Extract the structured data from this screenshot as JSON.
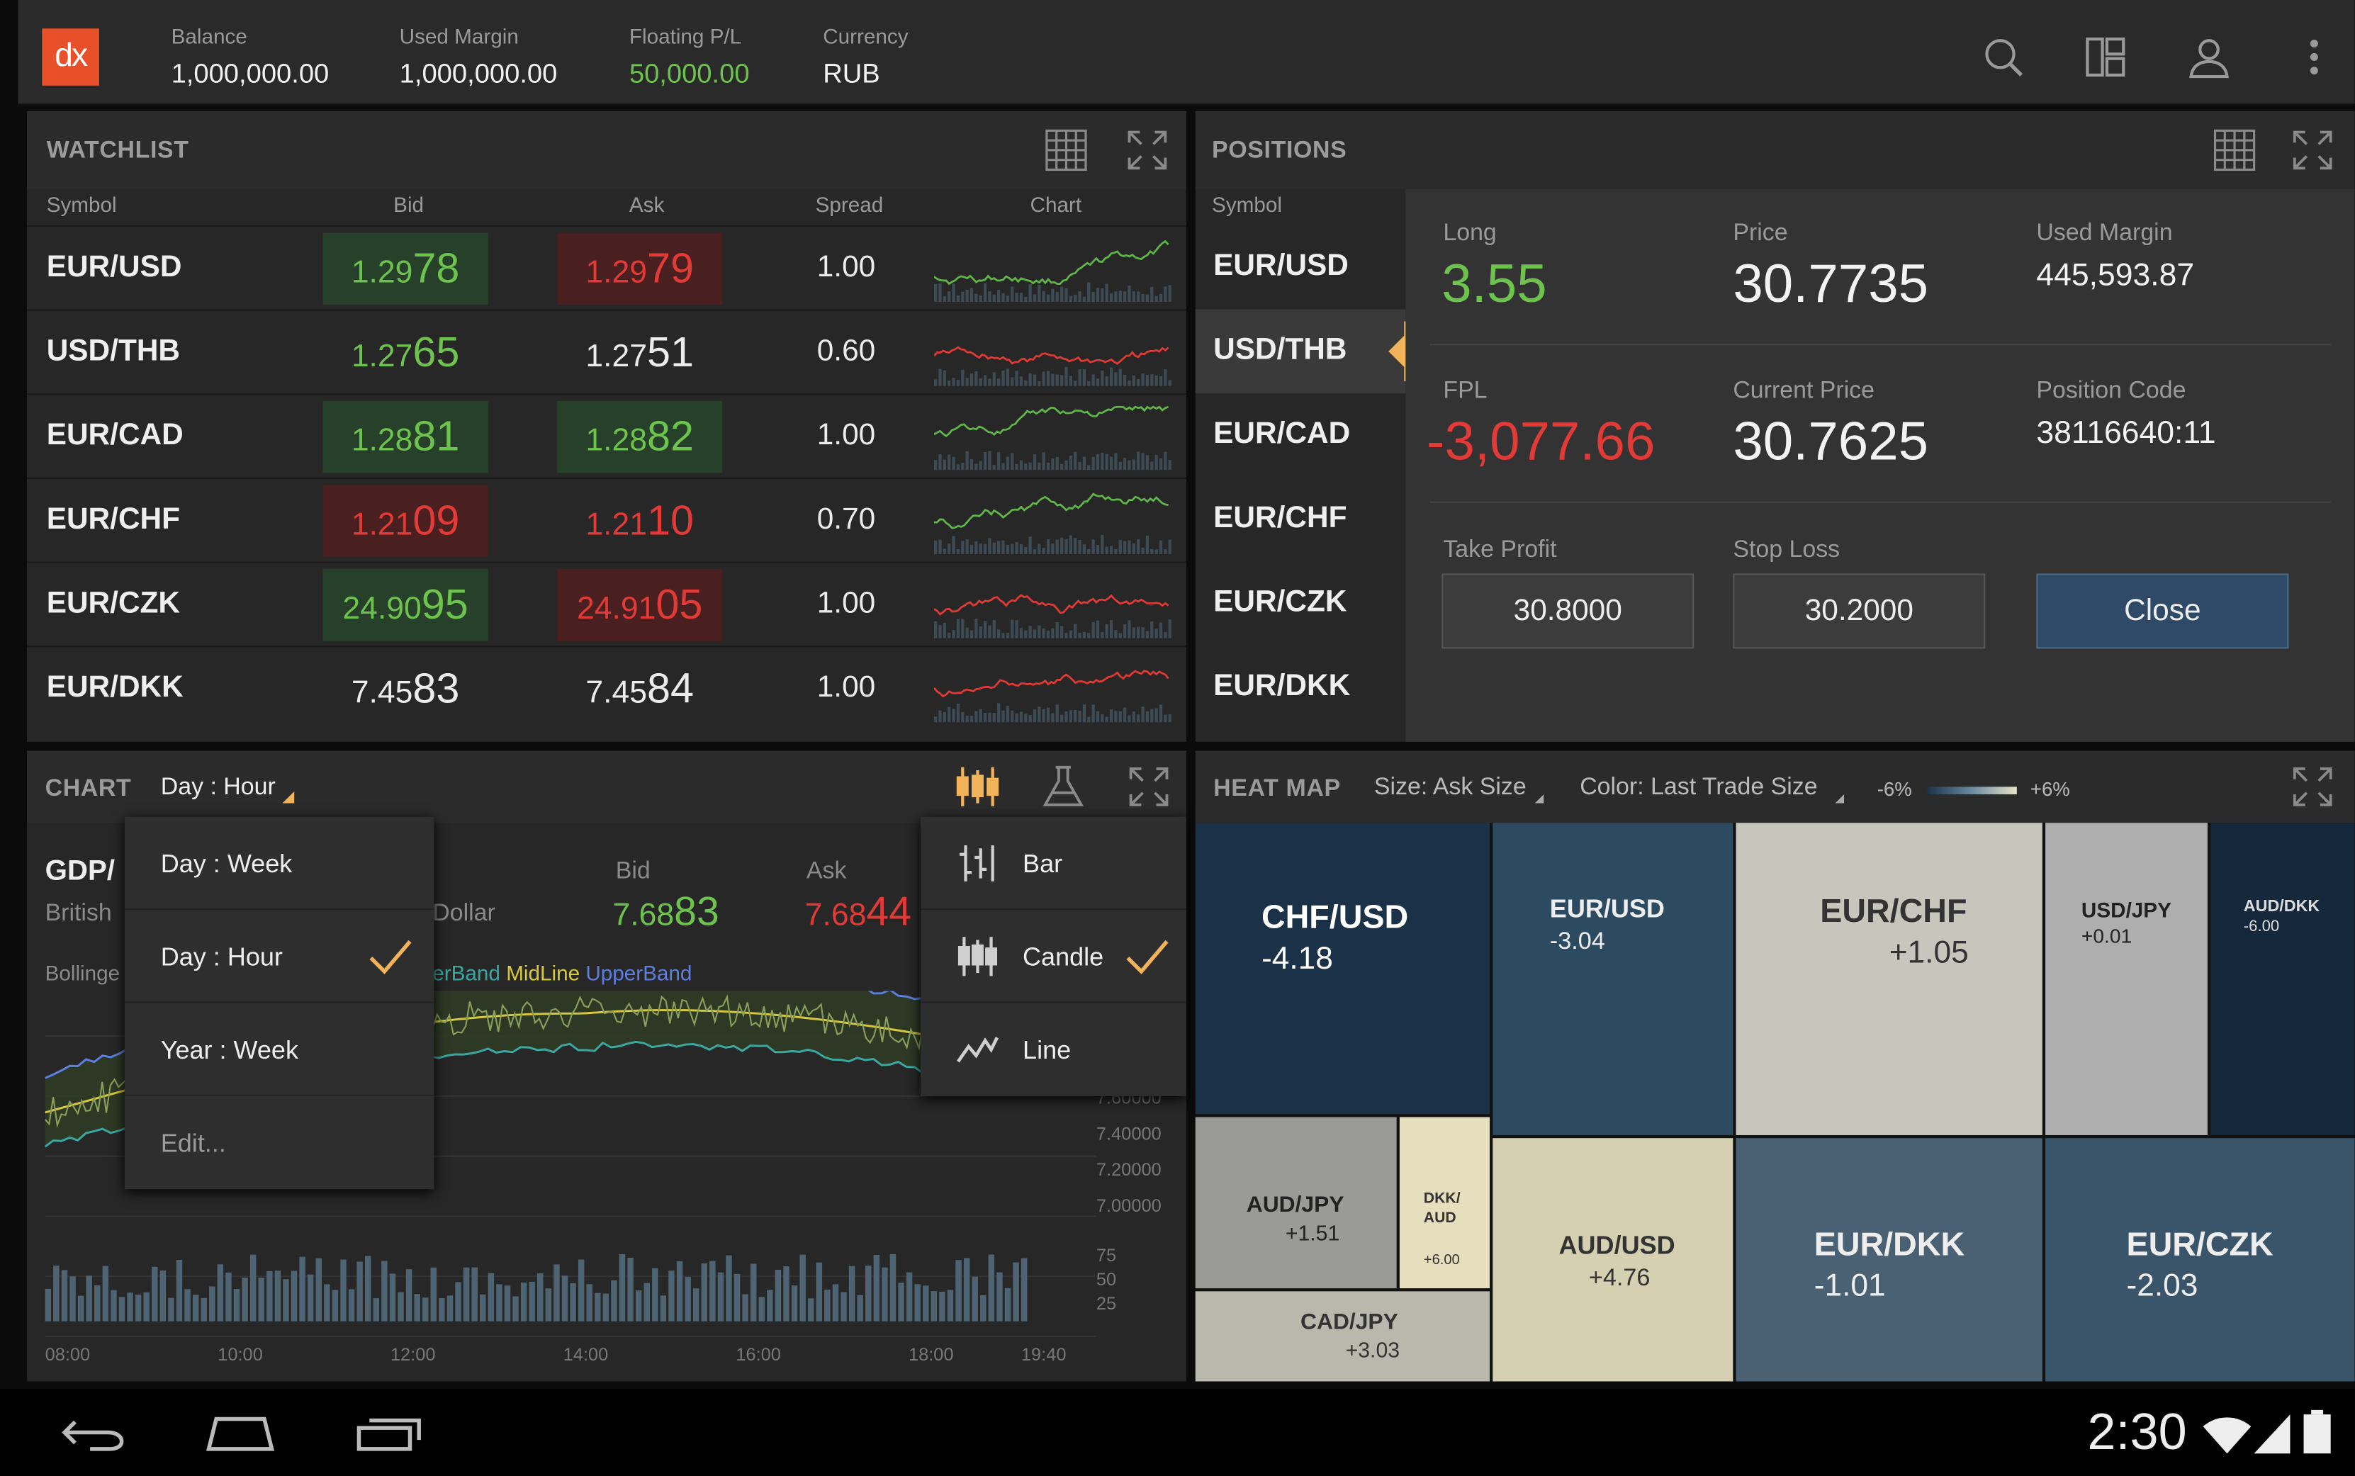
{
  "app": {
    "logo_text": "dx",
    "accent": "#e8502a"
  },
  "topbar": {
    "stats": [
      {
        "label": "Balance",
        "value": "1,000,000.00"
      },
      {
        "label": "Used Margin",
        "value": "1,000,000.00"
      },
      {
        "label": "Floating P/L",
        "value": "50,000.00"
      },
      {
        "label": "Currency",
        "value": "RUB"
      }
    ],
    "icons": [
      "search-icon",
      "layout-icon",
      "account-icon",
      "overflow-menu-icon"
    ]
  },
  "watchlist": {
    "title": "WATCHLIST",
    "columns": [
      "Symbol",
      "Bid",
      "Ask",
      "Spread",
      "Chart"
    ],
    "rows": [
      {
        "symbol": "EUR/USD",
        "bid_pre": "1.29",
        "bid_big": "78",
        "ask_pre": "1.29",
        "ask_big": "79",
        "spread": "1.00",
        "bid_state": "up",
        "ask_state": "down",
        "trend": "green"
      },
      {
        "symbol": "USD/THB",
        "bid_pre": "1.27",
        "bid_big": "65",
        "ask_pre": "1.27",
        "ask_big": "51",
        "spread": "0.60",
        "bid_state": "up-text",
        "ask_state": "neutral",
        "trend": "red"
      },
      {
        "symbol": "EUR/CAD",
        "bid_pre": "1.28",
        "bid_big": "81",
        "ask_pre": "1.28",
        "ask_big": "82",
        "spread": "1.00",
        "bid_state": "up",
        "ask_state": "up",
        "trend": "green"
      },
      {
        "symbol": "EUR/CHF",
        "bid_pre": "1.21",
        "bid_big": "09",
        "ask_pre": "1.21",
        "ask_big": "10",
        "spread": "0.70",
        "bid_state": "down",
        "ask_state": "down-text",
        "trend": "green"
      },
      {
        "symbol": "EUR/CZK",
        "bid_pre": "24.90",
        "bid_big": "95",
        "ask_pre": "24.91",
        "ask_big": "05",
        "spread": "1.00",
        "bid_state": "up",
        "ask_state": "down",
        "trend": "red"
      },
      {
        "symbol": "EUR/DKK",
        "bid_pre": "7.45",
        "bid_big": "83",
        "ask_pre": "7.45",
        "ask_big": "84",
        "spread": "1.00",
        "bid_state": "neutral",
        "ask_state": "neutral",
        "trend": "red"
      }
    ]
  },
  "positions": {
    "title": "POSITIONS",
    "column": "Symbol",
    "symbols": [
      "EUR/USD",
      "USD/THB",
      "EUR/CAD",
      "EUR/CHF",
      "EUR/CZK",
      "EUR/DKK"
    ],
    "selected": "USD/THB",
    "detail": {
      "long_label": "Long",
      "long_value": "3.55",
      "price_label": "Price",
      "price_value": "30.7735",
      "used_margin_label": "Used Margin",
      "used_margin_value": "445,593.87",
      "fpl_label": "FPL",
      "fpl_value": "-3,077.66",
      "current_price_label": "Current Price",
      "current_price_value": "30.7625",
      "position_code_label": "Position Code",
      "position_code_value": "38116640:11",
      "take_profit_label": "Take Profit",
      "take_profit_value": "30.8000",
      "stop_loss_label": "Stop Loss",
      "stop_loss_value": "30.2000",
      "close_label": "Close"
    }
  },
  "chart_panel": {
    "title": "CHART",
    "period": "Day : Hour",
    "symbol_partial": "GDP/",
    "desc_partial": "British",
    "desc_partial2": "Dollar",
    "indicator_partial": "Bollinge",
    "legend": {
      "lower": "erBand",
      "mid": "MidLine",
      "upper": "UpperBand"
    },
    "bid_label": "Bid",
    "bid_pre": "7.68",
    "bid_big": "83",
    "ask_label": "Ask",
    "ask_pre": "7.68",
    "ask_big": "44",
    "price_ticks": [
      "7.60000",
      "7.40000",
      "7.20000",
      "7.00000"
    ],
    "volume_ticks": [
      "75",
      "50",
      "25"
    ],
    "time_ticks": [
      "08:00",
      "10:00",
      "12:00",
      "14:00",
      "16:00",
      "18:00",
      "19:40"
    ],
    "period_menu": [
      {
        "label": "Day : Week",
        "checked": false
      },
      {
        "label": "Day : Hour",
        "checked": true
      },
      {
        "label": "Year : Week",
        "checked": false
      },
      {
        "label": "Edit...",
        "checked": false
      }
    ],
    "type_menu": [
      {
        "label": "Bar",
        "icon": "bar-chart-icon",
        "checked": false
      },
      {
        "label": "Candle",
        "icon": "candle-chart-icon",
        "checked": true
      },
      {
        "label": "Line",
        "icon": "line-chart-icon",
        "checked": false
      }
    ]
  },
  "heatmap": {
    "title": "HEAT MAP",
    "size_label": "Size: Ask Size",
    "color_label": "Color: Last Trade Size",
    "scale_min": "-6%",
    "scale_max": "+6%",
    "tiles": [
      {
        "symbol": "CHF/USD",
        "value": "-4.18",
        "color": "#1b3147"
      },
      {
        "symbol": "EUR/USD",
        "value": "-3.04",
        "color": "#2d4b60"
      },
      {
        "symbol": "EUR/CHF",
        "value": "+1.05",
        "color": "#c7c6bd"
      },
      {
        "symbol": "USD/JPY",
        "value": "+0.01",
        "color": "#aeaeae"
      },
      {
        "symbol": "AUD/DKK",
        "value": "-6.00",
        "color": "#15273a"
      },
      {
        "symbol": "AUD/JPY",
        "value": "+1.51",
        "color": "#9a9a97"
      },
      {
        "symbol": "DKK/ AUD",
        "value": "+6.00",
        "color": "#e6dfbd"
      },
      {
        "symbol": "CAD/JPY",
        "value": "+3.03",
        "color": "#b9b8ad"
      },
      {
        "symbol": "AUD/USD",
        "value": "+4.76",
        "color": "#d5d0b2"
      },
      {
        "symbol": "EUR/DKK",
        "value": "-1.01",
        "color": "#4a6174"
      },
      {
        "symbol": "EUR/CZK",
        "value": "-2.03",
        "color": "#3a5569"
      }
    ]
  },
  "statusbar": {
    "time": "2:30"
  },
  "colors": {
    "positive": "#6ec24e",
    "negative": "#e23a37",
    "close_button": "#2e4a66",
    "selection": "#f3b35a"
  }
}
